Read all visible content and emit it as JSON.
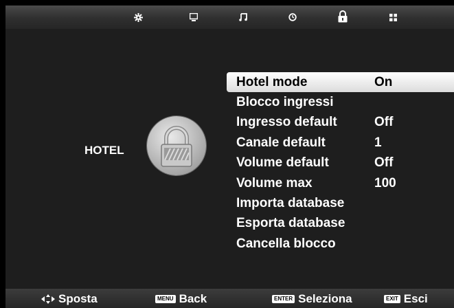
{
  "top_icons": [
    {
      "name": "picture-settings-icon"
    },
    {
      "name": "screen-icon"
    },
    {
      "name": "music-note-icon"
    },
    {
      "name": "timer-clock-icon"
    },
    {
      "name": "lock-icon"
    },
    {
      "name": "grid-options-icon"
    }
  ],
  "category": {
    "label": "HOTEL",
    "icon": "padlock-emblem-icon"
  },
  "menu": [
    {
      "label": "Hotel mode",
      "value": "On",
      "selected": true
    },
    {
      "label": "Blocco ingressi",
      "value": ""
    },
    {
      "label": "Ingresso default",
      "value": "Off"
    },
    {
      "label": "Canale default",
      "value": "1"
    },
    {
      "label": "Volume default",
      "value": "Off"
    },
    {
      "label": "Volume max",
      "value": "100"
    },
    {
      "label": "Importa database",
      "value": ""
    },
    {
      "label": "Esporta database",
      "value": ""
    },
    {
      "label": "Cancella blocco",
      "value": ""
    }
  ],
  "footer": {
    "move": {
      "icon": "navigation-arrows-icon",
      "label": "Sposta"
    },
    "back": {
      "key": "MENU",
      "label": "Back"
    },
    "select": {
      "key": "ENTER",
      "label": "Seleziona"
    },
    "exit": {
      "key": "EXIT",
      "label": "Esci"
    }
  },
  "colors": {
    "background": "#1e1e1e",
    "highlight": "#ffffff",
    "text": "#ffffff"
  }
}
